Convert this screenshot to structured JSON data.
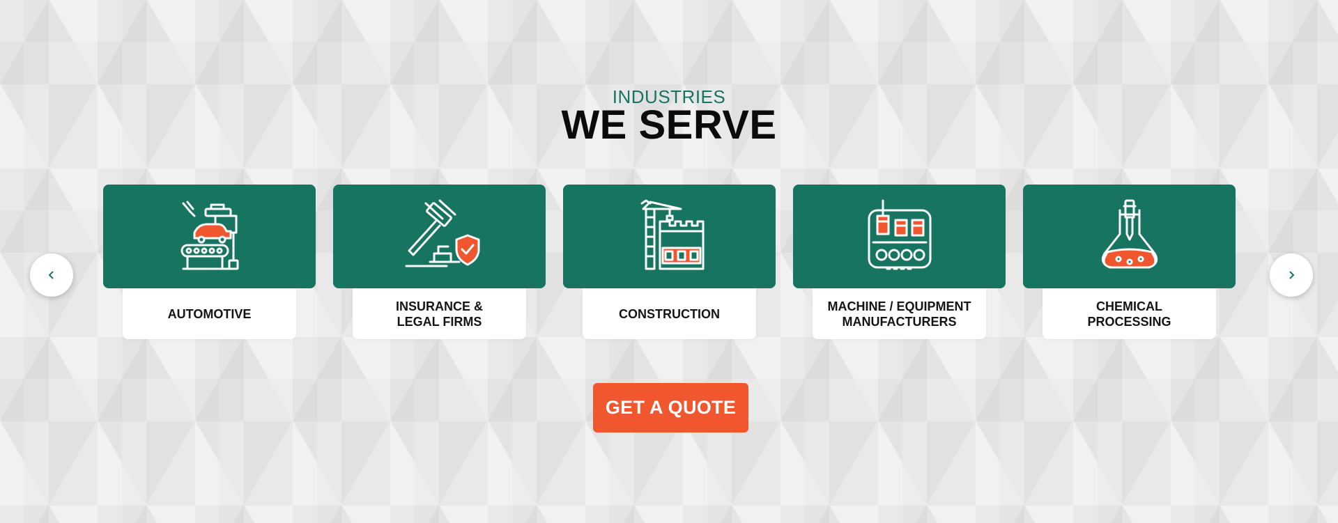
{
  "header": {
    "eyebrow": "INDUSTRIES",
    "title": "WE SERVE"
  },
  "carousel": {
    "prev_icon": "chevron-left-icon",
    "next_icon": "chevron-right-icon",
    "cards": [
      {
        "icon": "automotive-icon",
        "line1": "AUTOMOTIVE",
        "line2": ""
      },
      {
        "icon": "gavel-shield-icon",
        "line1": "INSURANCE &",
        "line2": "LEGAL FIRMS"
      },
      {
        "icon": "construction-crane-icon",
        "line1": "CONSTRUCTION",
        "line2": ""
      },
      {
        "icon": "machine-icon",
        "line1": "MACHINE / EQUIPMENT",
        "line2": "MANUFACTURERS"
      },
      {
        "icon": "chemical-flask-icon",
        "line1": "CHEMICAL",
        "line2": "PROCESSING"
      }
    ]
  },
  "cta": {
    "label": "GET A QUOTE"
  },
  "colors": {
    "brand_green": "#177460",
    "accent_orange": "#f1572f",
    "card_label_bg": "#ffffff",
    "background": "#e9e9e9"
  }
}
